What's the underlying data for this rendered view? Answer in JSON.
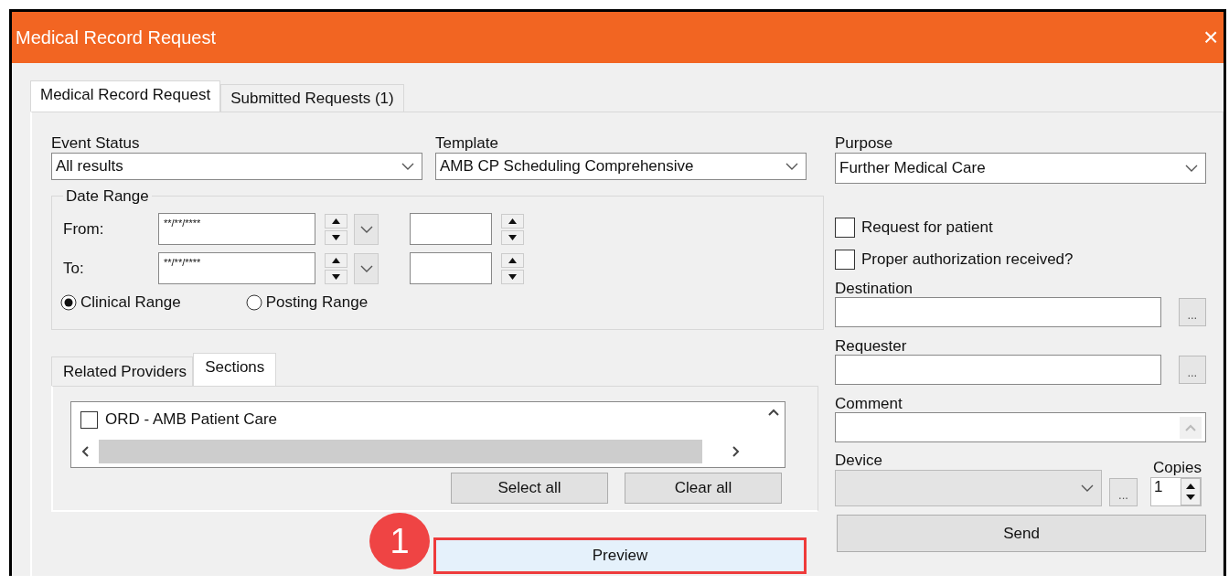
{
  "window": {
    "title": "Medical Record Request",
    "close": "×"
  },
  "tabs": [
    {
      "label": "Medical Record Request",
      "selected": true
    },
    {
      "label": "Submitted Requests (1)",
      "selected": false
    }
  ],
  "event_status": {
    "label": "Event Status",
    "value": "All results"
  },
  "template": {
    "label": "Template",
    "value": "AMB CP Scheduling Comprehensive"
  },
  "date_range": {
    "title": "Date Range",
    "rows": [
      {
        "label": "From:",
        "date": "**/**/****"
      },
      {
        "label": "To:",
        "date": "**/**/****"
      }
    ],
    "range_options": [
      {
        "label": "Clinical Range",
        "selected": true
      },
      {
        "label": "Posting Range",
        "selected": false
      }
    ]
  },
  "lower_tabs": [
    {
      "label": "Related Providers",
      "selected": false
    },
    {
      "label": "Sections",
      "selected": true
    }
  ],
  "sections": [
    {
      "label": "ORD - AMB Patient Care",
      "checked": false
    }
  ],
  "section_buttons": [
    "Select all",
    "Clear all"
  ],
  "preview": {
    "label": "Preview",
    "highlighted": true,
    "annotation": "1"
  },
  "purpose": {
    "label": "Purpose",
    "value": "Further Medical Care"
  },
  "options": [
    {
      "label": "Request for patient",
      "checked": false
    },
    {
      "label": "Proper authorization received?",
      "checked": false
    }
  ],
  "destination": {
    "label": "Destination",
    "browse": "..."
  },
  "requester": {
    "label": "Requester",
    "browse": "..."
  },
  "comment": {
    "label": "Comment"
  },
  "device": {
    "label": "Device",
    "disabled": true,
    "browse": "..."
  },
  "copies": {
    "label": "Copies",
    "value": "1"
  },
  "send": "Send"
}
